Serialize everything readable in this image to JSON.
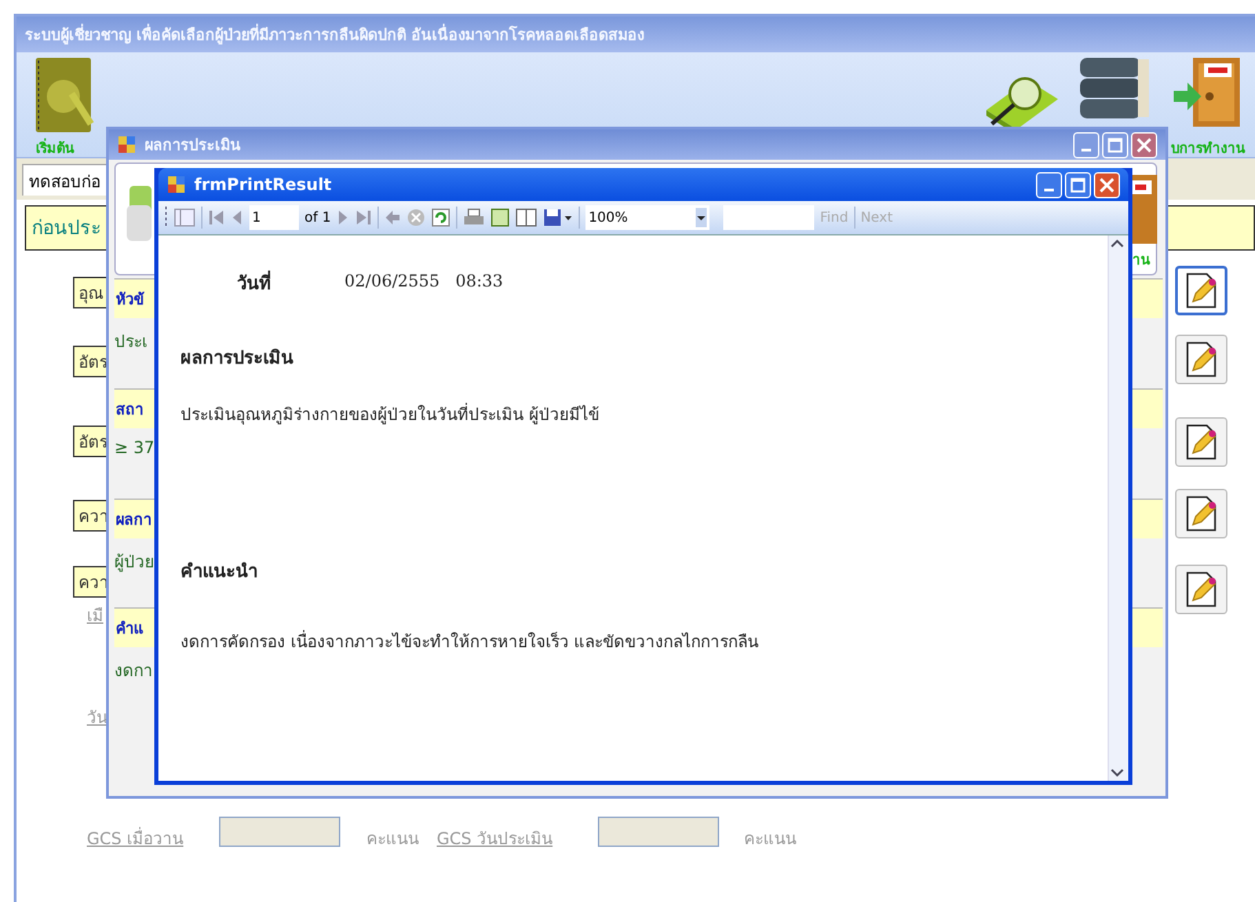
{
  "main_window": {
    "title": "ระบบผู้เชี่ยวชาญ เพื่อคัดเลือกผู้ป่วยที่มีภาวะการกลืนผิดปกติ อันเนื่องมาจากโรคหลอดเลือดสมอง",
    "start_label": "เริ่มต้น",
    "exit_label": "บการทำงาน",
    "tab": "ทดสอบก่อ",
    "section_header": "ก่อนประ",
    "field_labels": [
      {
        "text": "อุณ"
      },
      {
        "text": "อัตร"
      },
      {
        "text": "อัตร"
      },
      {
        "text": "ควา"
      },
      {
        "text": "ควา"
      }
    ],
    "edit_buttons": [
      {
        "selected": true
      },
      {
        "selected": false
      },
      {
        "selected": false
      },
      {
        "selected": false
      },
      {
        "selected": false
      }
    ],
    "links": [
      "เมื",
      "วัน"
    ],
    "gcs_row": {
      "label_1": "GCS เมื่อวาน",
      "unit_1": "คะแนน",
      "label_2": "GCS วันประเมิน",
      "unit_2": "คะแนน"
    }
  },
  "assessment_window": {
    "title": "ผลการประเมิน",
    "exit_label": "าน",
    "sections": [
      {
        "heading": "หัวข้",
        "text": "ประเ"
      },
      {
        "heading": "สถา",
        "text": "≥ 37"
      },
      {
        "heading": "ผลกา",
        "text": "ผู้ป่วย"
      },
      {
        "heading": "คำแ",
        "text": "งดกา"
      }
    ]
  },
  "print_window": {
    "title": "frmPrintResult",
    "toolbar": {
      "page": "1",
      "page_of": "of 1",
      "zoom": "100%",
      "find": "Find",
      "next": "Next"
    },
    "report": {
      "date_label": "วันที่",
      "date_value": "02/06/2555   08:33",
      "result_heading": "ผลการประเมิน",
      "result_text": "ประเมินอุณหภูมิร่างกายของผู้ป่วยในวันที่ประเมิน ผู้ป่วยมีไข้",
      "advice_heading": "คำแนะนำ",
      "advice_text": "งดการคัดกรอง เนื่องจากภาวะไข้จะทำให้การหายใจเร็ว และขัดขวางกลไกการกลืน"
    }
  }
}
